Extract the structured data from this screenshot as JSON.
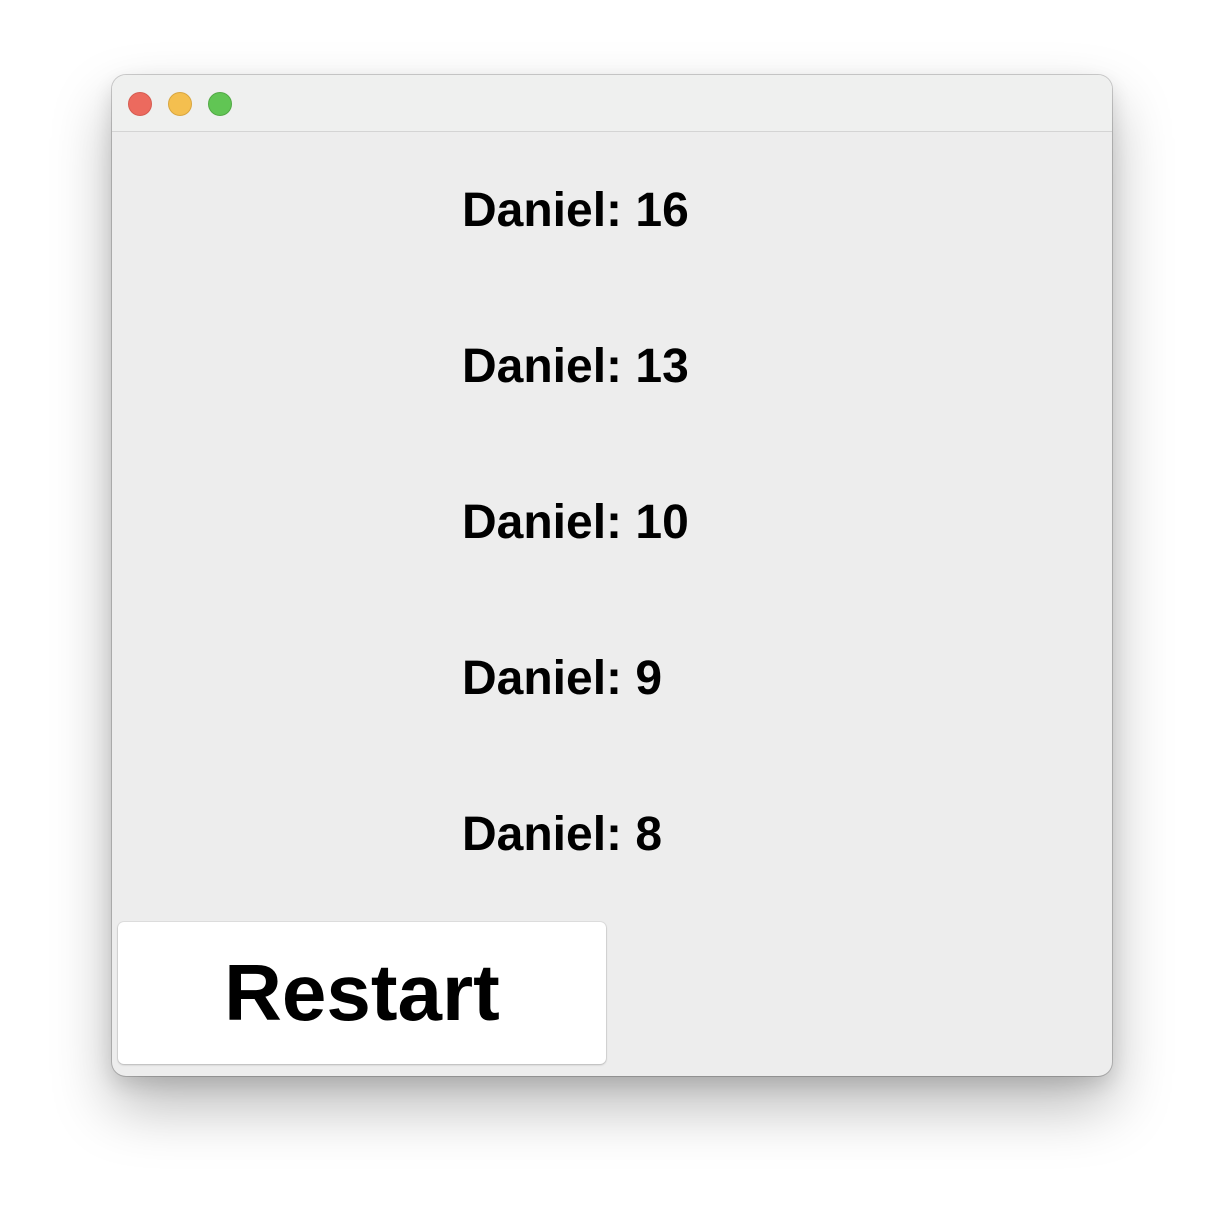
{
  "window": {
    "controls": {
      "close": "close-button",
      "minimize": "minimize-button",
      "maximize": "maximize-button"
    },
    "colors": {
      "close": "#ec6a5e",
      "minimize": "#f4bf4f",
      "maximize": "#61c554",
      "background": "#ededed"
    }
  },
  "scores": [
    "Daniel: 16",
    "Daniel: 13",
    "Daniel: 10",
    "Daniel: 9",
    "Daniel: 8"
  ],
  "restart_button": {
    "label": "Restart"
  }
}
